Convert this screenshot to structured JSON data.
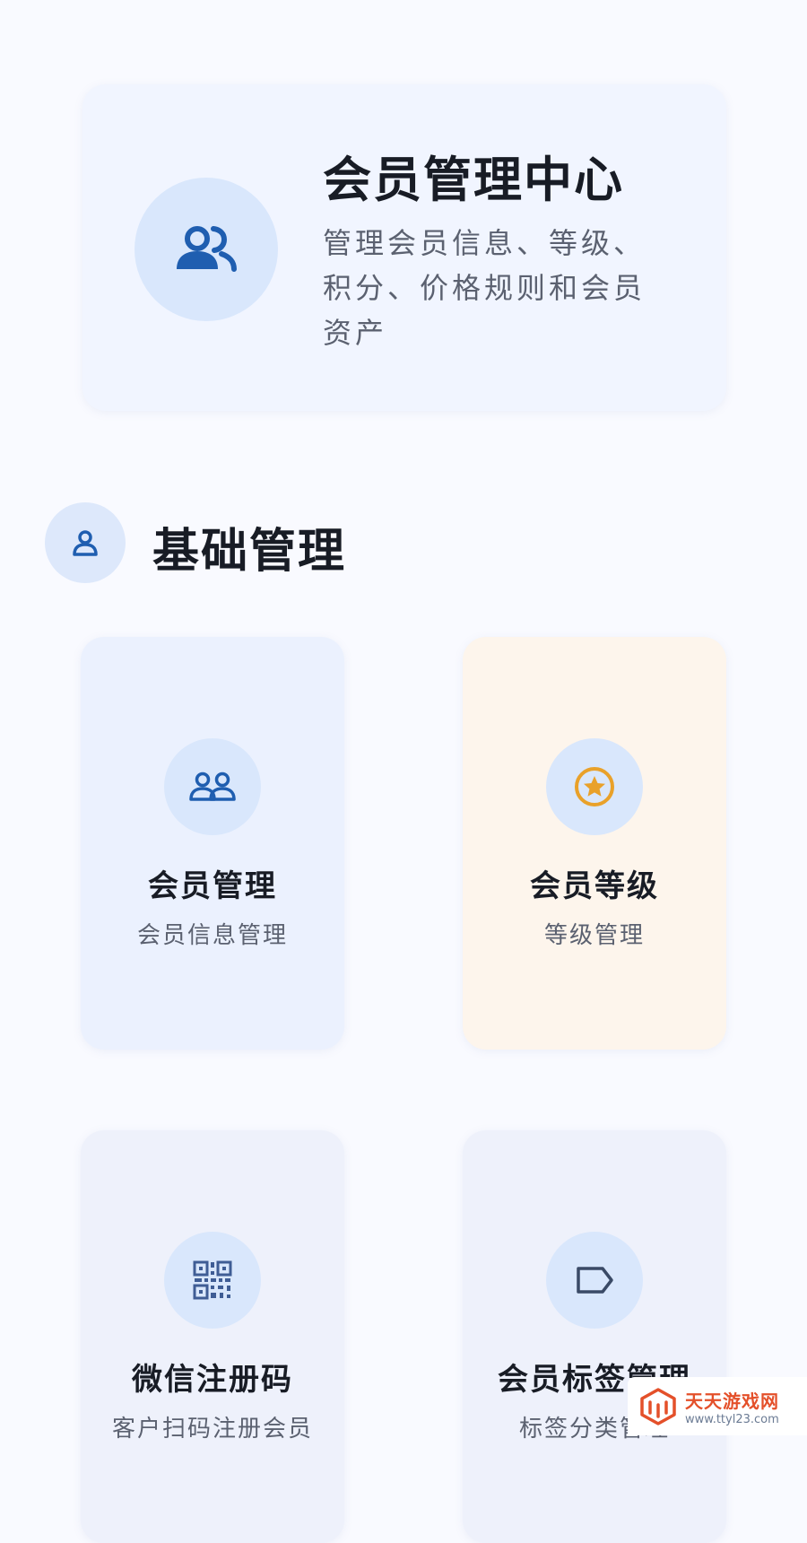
{
  "header": {
    "title": "会员管理中心",
    "description": "管理会员信息、等级、积分、价格规则和会员资产",
    "icon": "users-icon"
  },
  "section": {
    "title": "基础管理",
    "icon": "user-icon"
  },
  "tiles": [
    {
      "title": "会员管理",
      "subtitle": "会员信息管理",
      "icon": "users-icon"
    },
    {
      "title": "会员等级",
      "subtitle": "等级管理",
      "icon": "star-badge-icon"
    },
    {
      "title": "微信注册码",
      "subtitle": "客户扫码注册会员",
      "icon": "qr-code-icon"
    },
    {
      "title": "会员标签管理",
      "subtitle": "标签分类管理",
      "icon": "tag-icon"
    }
  ],
  "watermark": {
    "text": "天天游戏网",
    "url": "www.ttyl23.com"
  },
  "colors": {
    "primary": "#1f5eb0",
    "gold": "#e9a12a",
    "hero_bg": "#f1f5ff",
    "icon_circle": "#d9e7fc",
    "peach_bg": "#fdf5ec"
  }
}
